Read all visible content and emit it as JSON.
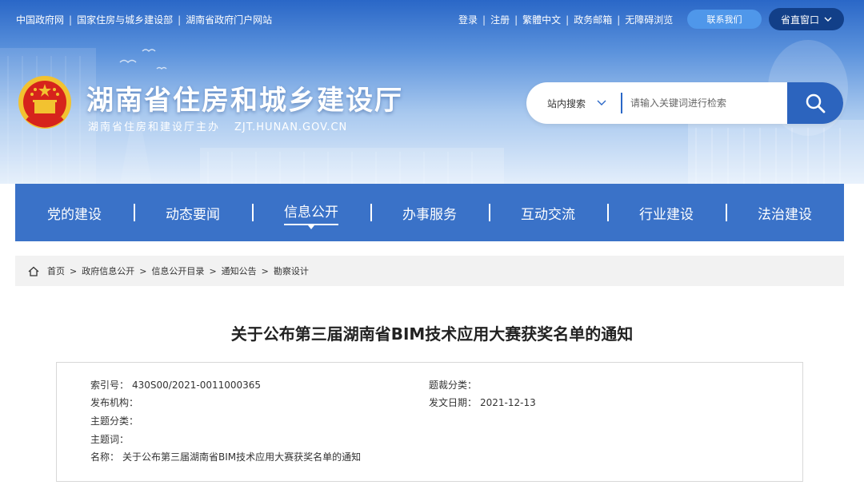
{
  "topbar": {
    "left_links": [
      "中国政府网",
      "国家住房与城乡建设部",
      "湖南省政府门户网站"
    ],
    "right_links": [
      "登录",
      "注册",
      "繁體中文",
      "政务邮箱",
      "无障碍浏览"
    ],
    "contact_label": "联系我们",
    "province_label": "省直窗口"
  },
  "header": {
    "title": "湖南省住房和城乡建设厅",
    "subtitle": "湖南省住房和建设厅主办",
    "domain": "ZJT.HUNAN.GOV.CN"
  },
  "search": {
    "scope": "站内搜索",
    "placeholder": "请输入关键词进行检索"
  },
  "nav": {
    "items": [
      {
        "label": "党的建设"
      },
      {
        "label": "动态要闻"
      },
      {
        "label": "信息公开"
      },
      {
        "label": "办事服务"
      },
      {
        "label": "互动交流"
      },
      {
        "label": "行业建设"
      },
      {
        "label": "法治建设"
      }
    ],
    "active_index": 2
  },
  "breadcrumb": [
    "首页",
    "政府信息公开",
    "信息公开目录",
    "通知公告",
    "勘察设计"
  ],
  "article": {
    "title": "关于公布第三届湖南省BIM技术应用大赛获奖名单的通知",
    "meta": {
      "index_no_label": "索引号：",
      "index_no": "430S00/2021-0011000365",
      "category_label": "题裁分类：",
      "category": "",
      "publisher_label": "发布机构：",
      "publisher": "",
      "date_label": "发文日期：",
      "date": "2021-12-13",
      "topic_label": "主题分类：",
      "topic": "",
      "keyword_label": "主题词：",
      "keyword": "",
      "name_label": "名称：",
      "name": "关于公布第三届湖南省BIM技术应用大赛获奖名单的通知"
    }
  },
  "colors": {
    "brand_blue": "#3a72c8",
    "dark_blue": "#123f88",
    "search_button": "#2c64be"
  }
}
